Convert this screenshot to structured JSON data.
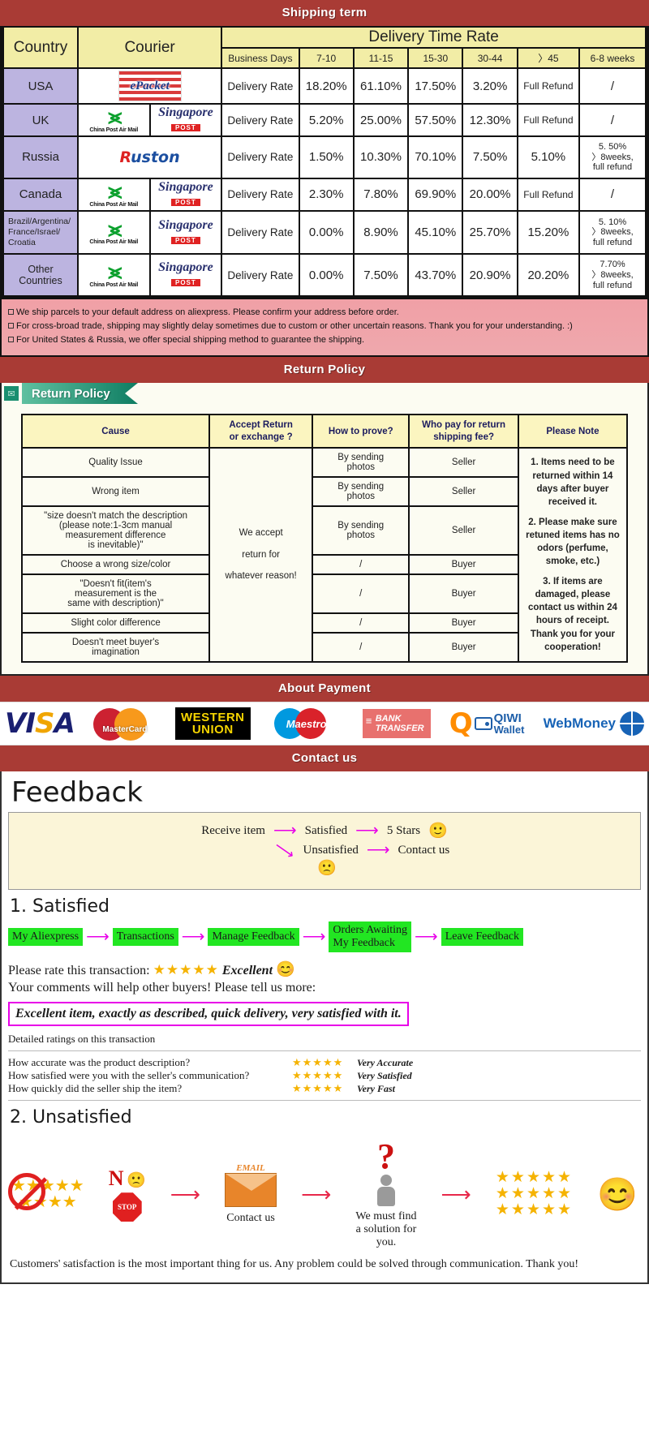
{
  "banners": {
    "shipping": "Shipping term",
    "return": "Return Policy",
    "payment": "About Payment",
    "contact": "Contact us"
  },
  "shipping_table": {
    "headers": {
      "country": "Country",
      "courier": "Courier",
      "delivery_time_rate": "Delivery Time Rate",
      "business_days": "Business Days",
      "ranges": [
        "7-10",
        "11-15",
        "15-30",
        "30-44",
        "〉45",
        "6-8 weeks"
      ]
    },
    "rate_label": "Delivery Rate",
    "rows": [
      {
        "country": "USA",
        "couriers": [
          "epacket"
        ],
        "values": [
          "18.20%",
          "61.10%",
          "17.50%",
          "3.20%",
          "Full Refund",
          "/"
        ]
      },
      {
        "country": "UK",
        "couriers": [
          "china-post-air-mail",
          "singapore-post"
        ],
        "values": [
          "5.20%",
          "25.00%",
          "57.50%",
          "12.30%",
          "Full Refund",
          "/"
        ]
      },
      {
        "country": "Russia",
        "couriers": [
          "ruston"
        ],
        "values": [
          "1.50%",
          "10.30%",
          "70.10%",
          "7.50%",
          "5.10%",
          "5. 50%\n〉8weeks,\nfull refund"
        ]
      },
      {
        "country": "Canada",
        "couriers": [
          "china-post-air-mail",
          "singapore-post"
        ],
        "values": [
          "2.30%",
          "7.80%",
          "69.90%",
          "20.00%",
          "Full Refund",
          "/"
        ]
      },
      {
        "country": "Brazil/Argentina/\nFrance/Israel/\nCroatia",
        "couriers": [
          "china-post-air-mail",
          "singapore-post"
        ],
        "values": [
          "0.00%",
          "8.90%",
          "45.10%",
          "25.70%",
          "15.20%",
          "5. 10%\n〉8weeks,\nfull refund"
        ]
      },
      {
        "country": "Other Countries",
        "couriers": [
          "china-post-air-mail",
          "singapore-post"
        ],
        "values": [
          "0.00%",
          "7.50%",
          "43.70%",
          "20.90%",
          "20.20%",
          "7.70%\n〉8weeks,\nfull refund"
        ]
      }
    ],
    "notes": [
      "We ship parcels to your default address on aliexpress. Please confirm your address before order.",
      "For cross-broad trade, shipping may slightly delay sometimes due to custom or other uncertain reasons. Thank you for your understanding. :)",
      "For United States & Russia, we offer special shipping method to guarantee the shipping."
    ],
    "courier_logos": {
      "epacket": "ePacket",
      "china_post": "China Post Air Mail",
      "singapore_post_sig": "Singapore",
      "singapore_post_tag": "POST",
      "ruston": "Ruston"
    }
  },
  "return_policy": {
    "tag_label": "Return Policy",
    "headers": [
      "Cause",
      "Accept Return\nor exchange ?",
      "How to prove?",
      "Who pay for return\nshipping fee?",
      "Please Note"
    ],
    "accept_text": "We accept\nreturn for\nwhatever reason!",
    "rows": [
      {
        "cause": "Quality Issue",
        "prove": "By sending\nphotos",
        "payer": "Seller"
      },
      {
        "cause": "Wrong item",
        "prove": "By sending\nphotos",
        "payer": "Seller"
      },
      {
        "cause": "\"size doesn't match the description\n(please note:1-3cm manual\nmeasurement difference\nis inevitable)\"",
        "prove": "By sending\nphotos",
        "payer": "Seller"
      },
      {
        "cause": "Choose a wrong size/color",
        "prove": "/",
        "payer": "Buyer"
      },
      {
        "cause": "\"Doesn't fit(item's\nmeasurement is the\nsame with description)\"",
        "prove": "/",
        "payer": "Buyer"
      },
      {
        "cause": "Slight color difference",
        "prove": "/",
        "payer": "Buyer"
      },
      {
        "cause": "Doesn't meet buyer's\nimagination",
        "prove": "/",
        "payer": "Buyer"
      }
    ],
    "notes": [
      "1. Items need to be returned within 14 days after buyer received it.",
      "2. Please make sure retuned items has no odors (perfume, smoke, etc.)",
      "3. If items are damaged, please contact us within 24 hours of receipt.",
      "Thank you for your cooperation!"
    ]
  },
  "payment_methods": [
    {
      "name": "visa",
      "label": "VISA"
    },
    {
      "name": "mastercard",
      "label": "MasterCard"
    },
    {
      "name": "western-union",
      "line1": "WESTERN",
      "line2": "UNION"
    },
    {
      "name": "maestro",
      "label": "Maestro"
    },
    {
      "name": "bank-transfer",
      "line1": "BANK",
      "line2": "TRANSFER"
    },
    {
      "name": "qiwi-wallet",
      "line1": "QIWI",
      "line2": "Wallet"
    },
    {
      "name": "webmoney",
      "label": "WebMoney"
    }
  ],
  "feedback": {
    "title": "Feedback",
    "flow": {
      "receive": "Receive item",
      "satisfied": "Satisfied",
      "five_stars": "5 Stars",
      "unsatisfied": "Unsatisfied",
      "contact": "Contact us",
      "happy_face": "🙂",
      "sad_face": "🙁"
    },
    "section1_title": "1. Satisfied",
    "chain": [
      "My Aliexpress",
      "Transactions",
      "Manage Feedback",
      "Orders Awaiting\nMy Feedback",
      "Leave Feedback"
    ],
    "rate_line": "Please rate this transaction:",
    "rate_stars": "★★★★★",
    "rate_word": "Excellent",
    "rate_emoji": "😊",
    "comments_line": "Your comments will help other buyers! Please tell us more:",
    "excellent_quote": "Excellent item, exactly as described, quick delivery, very satisfied with it.",
    "detailed_title": "Detailed ratings on this transaction",
    "detailed": [
      {
        "question": "How accurate was the product description?",
        "stars": "★★★★★",
        "value": "Very Accurate"
      },
      {
        "question": "How satisfied were you with the seller's communication?",
        "stars": "★★★★★",
        "value": "Very Satisfied"
      },
      {
        "question": "How quickly did the seller ship the item?",
        "stars": "★★★★★",
        "value": "Very Fast"
      }
    ],
    "section2_title": "2. Unsatisfied",
    "unsat": {
      "no_label": "N",
      "stop_label": "STOP",
      "email_label": "EMAIL",
      "contact_us": "Contact us",
      "solution": "We must find\na solution for\nyou.",
      "stars_block": "★★★★★\n★★★★★\n★★★★★",
      "final_emoji": "😊"
    },
    "closing": "Customers' satisfaction is the most important thing for us. Any problem could be solved through communication. Thank you!"
  }
}
